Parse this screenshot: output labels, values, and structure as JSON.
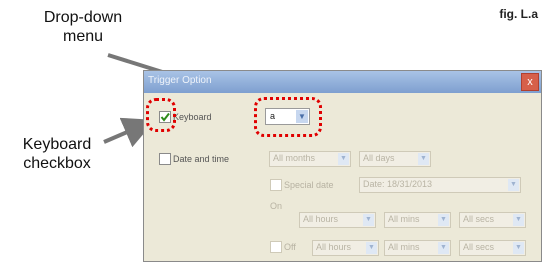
{
  "annotations": {
    "dropdown_label": "Drop-down\nmenu",
    "checkbox_label": "Keyboard\ncheckbox",
    "figure": "fig. L.a"
  },
  "window": {
    "title": "Trigger Option",
    "close": "x"
  },
  "keyboard": {
    "label": "Keyboard",
    "checked": true,
    "key_value": "a"
  },
  "date_time": {
    "label": "Date and time",
    "checked": false,
    "months": "All months",
    "days": "All days",
    "special_date": "Special date",
    "date_value": "Date: 18/31/2013",
    "on": "On",
    "off": "Off",
    "hours": "All hours",
    "minutes": "All mins",
    "seconds": "All secs"
  }
}
